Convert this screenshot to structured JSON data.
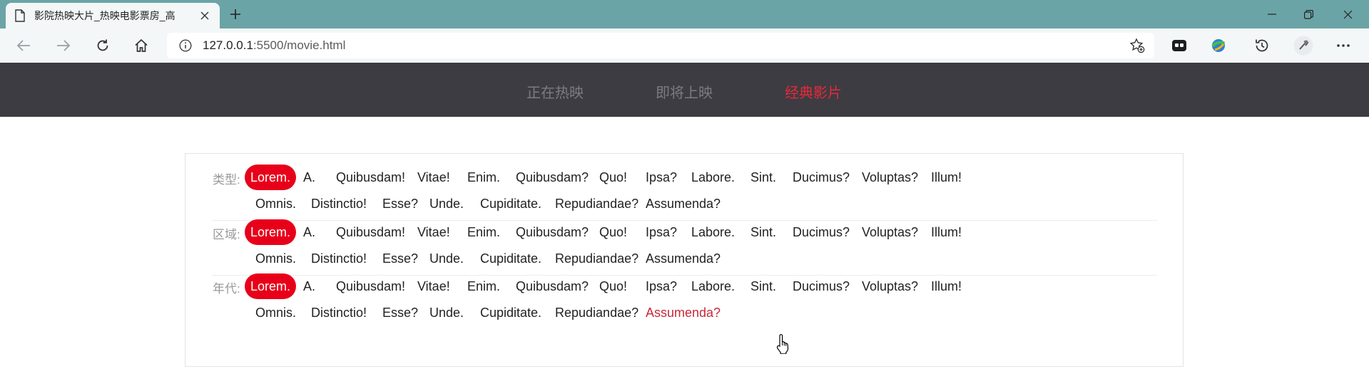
{
  "browser": {
    "tab_title": "影院热映大片_热映电影票房_高",
    "url_host": "127.0.0.1",
    "url_path": ":5500/movie.html"
  },
  "nav": {
    "items": [
      {
        "label": "正在热映"
      },
      {
        "label": "即将上映"
      },
      {
        "label": "经典影片"
      }
    ],
    "active_index": 2
  },
  "filters": [
    {
      "label": "类型:",
      "options": [
        "Lorem.",
        "A.",
        "Quibusdam!",
        "Vitae!",
        "Enim.",
        "Quibusdam?",
        "Quo!",
        "Ipsa?",
        "Labore.",
        "Sint.",
        "Ducimus?",
        "Voluptas?",
        "Illum!",
        "Omnis.",
        "Distinctio!",
        "Esse?",
        "Unde.",
        "Cupiditate.",
        "Repudiandae?",
        "Assumenda?"
      ],
      "selected": 0
    },
    {
      "label": "区域:",
      "options": [
        "Lorem.",
        "A.",
        "Quibusdam!",
        "Vitae!",
        "Enim.",
        "Quibusdam?",
        "Quo!",
        "Ipsa?",
        "Labore.",
        "Sint.",
        "Ducimus?",
        "Voluptas?",
        "Illum!",
        "Omnis.",
        "Distinctio!",
        "Esse?",
        "Unde.",
        "Cupiditate.",
        "Repudiandae?",
        "Assumenda?"
      ],
      "selected": 0
    },
    {
      "label": "年代:",
      "options": [
        "Lorem.",
        "A.",
        "Quibusdam!",
        "Vitae!",
        "Enim.",
        "Quibusdam?",
        "Quo!",
        "Ipsa?",
        "Labore.",
        "Sint.",
        "Ducimus?",
        "Voluptas?",
        "Illum!",
        "Omnis.",
        "Distinctio!",
        "Esse?",
        "Unde.",
        "Cupiditate.",
        "Repudiandae?",
        "Assumenda?"
      ],
      "selected": 0,
      "hovered": 19
    }
  ],
  "colors": {
    "titlebar": "#6ba4a6",
    "nav_bg": "#3d3c42",
    "accent": "#e8001a",
    "active_nav": "#e8283a"
  }
}
